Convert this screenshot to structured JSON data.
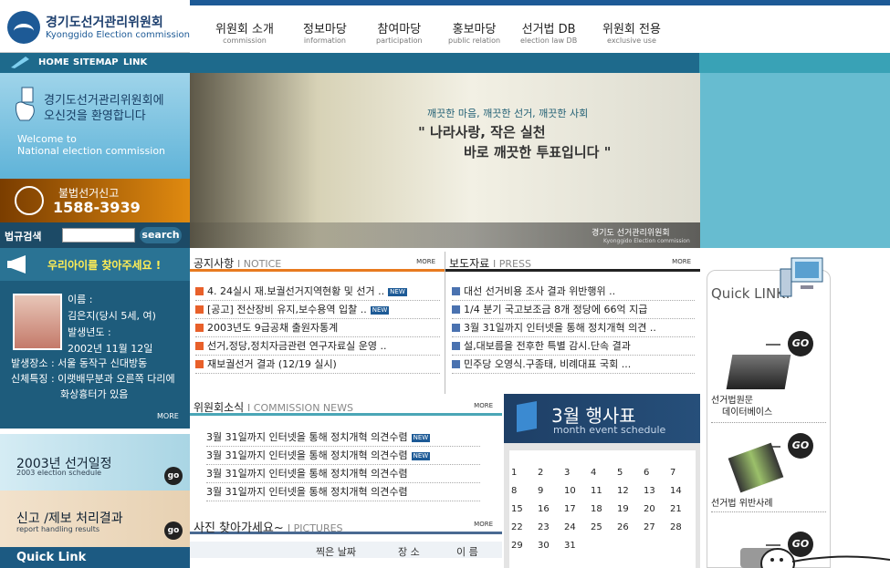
{
  "logo": {
    "title": "경기도선거관리위원회",
    "subtitle": "Kyonggido Election commission"
  },
  "nav": [
    {
      "k": "위원회 소개",
      "e": "commission"
    },
    {
      "k": "정보마당",
      "e": "information"
    },
    {
      "k": "참여마당",
      "e": "participation"
    },
    {
      "k": "홍보마당",
      "e": "public relation"
    },
    {
      "k": "선거법 DB",
      "e": "election law DB"
    },
    {
      "k": "위원회 전용",
      "e": "exclusive use"
    }
  ],
  "subnav": {
    "home": "HOME",
    "sitemap": "SITEMAP",
    "link": "LINK"
  },
  "welcome": {
    "line1": "경기도선거관리위원회에",
    "line2": "오신것을 환영합니다",
    "en1": "Welcome to",
    "en2": "National election commission"
  },
  "hotline": {
    "label": "불법선거신고",
    "number": "1588-3939"
  },
  "search": {
    "label": "법규검색",
    "button": "search"
  },
  "missing": {
    "title": "우리아이를 찾아주세요 !",
    "name": "이름 :",
    "name_val": "김은지(당시 5세, 여)",
    "date_label": "발생년도 :",
    "date_val": "2002년 11월 12일",
    "place": "발생장소 : 서울 동작구 신대방동",
    "feature1": "신체특징 : 이랫배무분과 오른쪽 다리에",
    "feature2": "화상흉터가 있음",
    "more": "MORE"
  },
  "schedule": {
    "title": "2003년 선거일정",
    "sub": "2003 election schedule",
    "go": "go"
  },
  "report": {
    "title": "신고 /제보 처리결과",
    "sub": "report handling results",
    "go": "go"
  },
  "quicklink_left": "Quick Link",
  "hero": {
    "slogan1": "깨끗한 마음, 깨끗한 선거, 깨끗한 사회",
    "slogan2": "\" 나라사랑, 작은 실천",
    "slogan3": "바로 깨끗한 투표입니다 \"",
    "logo_k": "경기도 선거관리위원회",
    "logo_e": "Kyonggido Election commission"
  },
  "notice": {
    "title": "공지사항",
    "en": "I NOTICE",
    "more": "MORE",
    "items": [
      {
        "text": "4. 24실시 재.보궐선거지역현황 및 선거 ..",
        "new": "NEW"
      },
      {
        "text": "[공고] 전산장비 유지,보수용역 입찰 ..",
        "new": "NEW"
      },
      {
        "text": "2003년도 9급공채 출원자통계",
        "new": ""
      },
      {
        "text": "선거,정당,정치자금관련 연구자료실 운영 ..",
        "new": ""
      },
      {
        "text": "재보궐선거 결과 (12/19 실시)",
        "new": ""
      }
    ]
  },
  "press": {
    "title": "보도자료",
    "en": "I PRESS",
    "more": "MORE",
    "items": [
      "대선 선거비용 조사 결과 위반행위 ..",
      "1/4 분기 국고보조금 8개 정당에 66억 지급",
      "3월 31일까지 인터넷을 통해 정치개혁 의견 ..",
      "설,대보름을 전후한 특별 감시.단속 결과",
      "민주당 오영식.구종태, 비례대표 국회 ..."
    ]
  },
  "commission": {
    "title": "위원회소식",
    "en": "I COMMISSION NEWS",
    "more": "MORE",
    "items": [
      {
        "text": "3월 31일까지 인터넷을 통해 정치개혁 의견수렴",
        "new": "NEW"
      },
      {
        "text": "3월 31일까지 인터넷을 통해 정치개혁 의견수렴",
        "new": "NEW"
      },
      {
        "text": "3월 31일까지 인터넷을 통해 정치개혁 의견수렴",
        "new": ""
      },
      {
        "text": "3월 31일까지 인터넷을 통해 정치개혁 의견수렴",
        "new": ""
      }
    ]
  },
  "month": {
    "title": "3월 행사표",
    "sub": "month event schedule"
  },
  "calendar": [
    [
      "1",
      "2",
      "3",
      "4",
      "5",
      "6",
      "7"
    ],
    [
      "8",
      "9",
      "10",
      "11",
      "12",
      "13",
      "14"
    ],
    [
      "15",
      "16",
      "17",
      "18",
      "19",
      "20",
      "21"
    ],
    [
      "22",
      "23",
      "24",
      "25",
      "26",
      "27",
      "28"
    ],
    [
      "29",
      "30",
      "31",
      "",
      "",
      "",
      ""
    ]
  ],
  "pictures": {
    "title": "사진 찾아가세요~",
    "en": "I PICTURES",
    "more": "MORE",
    "col1": "찍은 날짜",
    "col2": "장 소",
    "col3": "이 름"
  },
  "quick": {
    "title": "Quick LINK!",
    "go": "GO",
    "item1a": "선거법원문",
    "item1b": "데이터베이스",
    "item2": "선거법 위반사례"
  },
  "colors": {
    "navy": "#1d5a96",
    "orange": "#e87a1f",
    "teal": "#39a2b6"
  }
}
